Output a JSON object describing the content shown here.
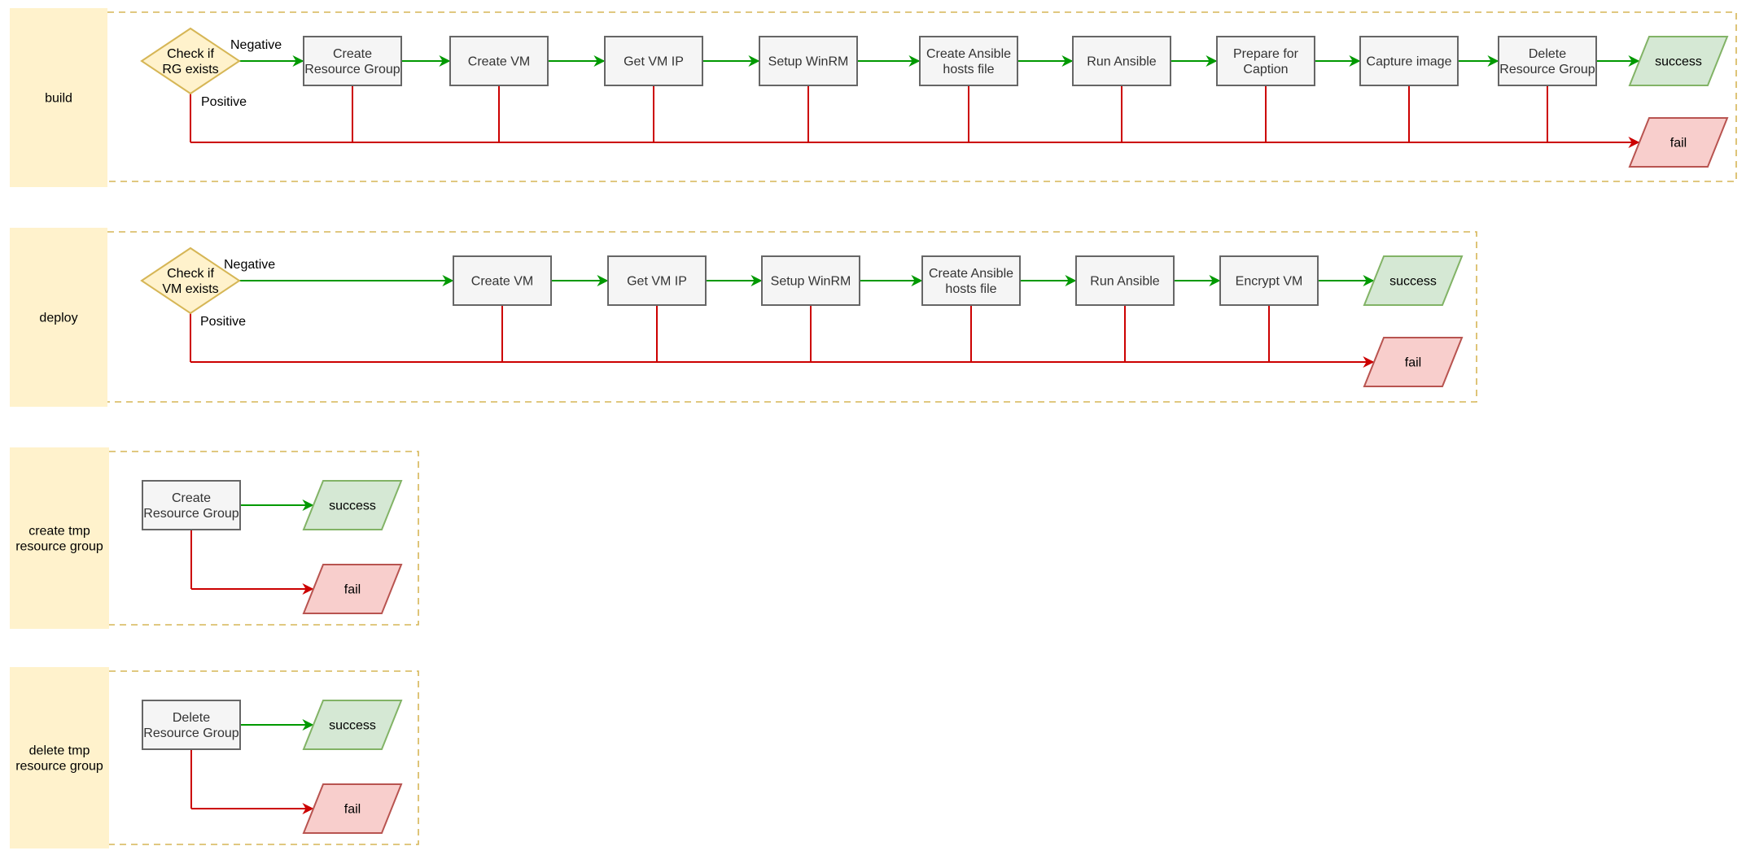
{
  "colors": {
    "success_edge": "#009900",
    "fail_edge": "#cc0000",
    "lane_fill": "#fff2cc",
    "lane_border": "#d6b656",
    "step_fill": "#f5f5f5",
    "step_stroke": "#666666",
    "success_fill": "#d5e8d4",
    "success_stroke": "#82b366",
    "fail_fill": "#f8cecc",
    "fail_stroke": "#b85450"
  },
  "lanes": [
    {
      "id": "build",
      "title": [
        "build"
      ],
      "decision": {
        "lines": [
          "Check if",
          "RG exists"
        ],
        "negative_label": "Negative",
        "positive_label": "Positive"
      },
      "steps": [
        {
          "lines": [
            "Create",
            "Resource Group"
          ]
        },
        {
          "lines": [
            "Create VM"
          ]
        },
        {
          "lines": [
            "Get VM IP"
          ]
        },
        {
          "lines": [
            "Setup WinRM"
          ]
        },
        {
          "lines": [
            "Create Ansible",
            "hosts file"
          ]
        },
        {
          "lines": [
            "Run Ansible"
          ]
        },
        {
          "lines": [
            "Prepare for",
            "Caption"
          ]
        },
        {
          "lines": [
            "Capture image"
          ]
        },
        {
          "lines": [
            "Delete",
            "Resource Group"
          ]
        }
      ],
      "success_label": "success",
      "fail_label": "fail"
    },
    {
      "id": "deploy",
      "title": [
        "deploy"
      ],
      "decision": {
        "lines": [
          "Check if",
          "VM exists"
        ],
        "negative_label": "Negative",
        "positive_label": "Positive"
      },
      "steps": [
        {
          "lines": [
            "Create VM"
          ]
        },
        {
          "lines": [
            "Get VM IP"
          ]
        },
        {
          "lines": [
            "Setup WinRM"
          ]
        },
        {
          "lines": [
            "Create Ansible",
            "hosts file"
          ]
        },
        {
          "lines": [
            "Run Ansible"
          ]
        },
        {
          "lines": [
            "Encrypt VM"
          ]
        }
      ],
      "success_label": "success",
      "fail_label": "fail"
    },
    {
      "id": "create-tmp-resource-group",
      "title": [
        "create tmp",
        "resource group"
      ],
      "decision": null,
      "steps": [
        {
          "lines": [
            "Create",
            "Resource Group"
          ]
        }
      ],
      "success_label": "success",
      "fail_label": "fail"
    },
    {
      "id": "delete-tmp-resource-group",
      "title": [
        "delete tmp",
        "resource group"
      ],
      "decision": null,
      "steps": [
        {
          "lines": [
            "Delete",
            "Resource Group"
          ]
        }
      ],
      "success_label": "success",
      "fail_label": "fail"
    }
  ]
}
